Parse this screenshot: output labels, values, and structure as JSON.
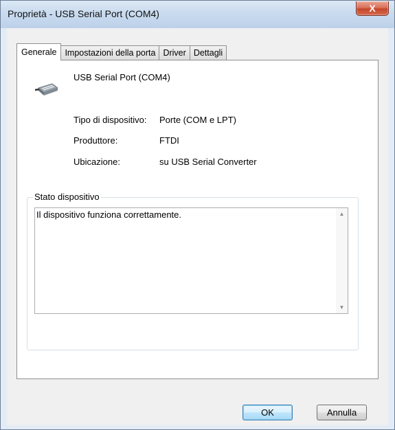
{
  "window": {
    "title": "Proprietà - USB Serial Port (COM4)",
    "close_label": "X"
  },
  "tabs": [
    {
      "label": "Generale",
      "active": true
    },
    {
      "label": "Impostazioni della porta",
      "active": false
    },
    {
      "label": "Driver",
      "active": false
    },
    {
      "label": "Dettagli",
      "active": false
    }
  ],
  "device": {
    "name": "USB Serial Port (COM4)",
    "icon": "serial-port-connector-icon",
    "properties": [
      {
        "label": "Tipo di dispositivo:",
        "value": "Porte (COM e LPT)"
      },
      {
        "label": "Produttore:",
        "value": "FTDI"
      },
      {
        "label": "Ubicazione:",
        "value": "su USB Serial Converter"
      }
    ]
  },
  "status": {
    "group_title": "Stato dispositivo",
    "text": "Il dispositivo funziona correttamente."
  },
  "buttons": {
    "ok": "OK",
    "cancel": "Annulla"
  },
  "colors": {
    "close_button": "#c4462b",
    "default_button": "#3c7fb1"
  }
}
